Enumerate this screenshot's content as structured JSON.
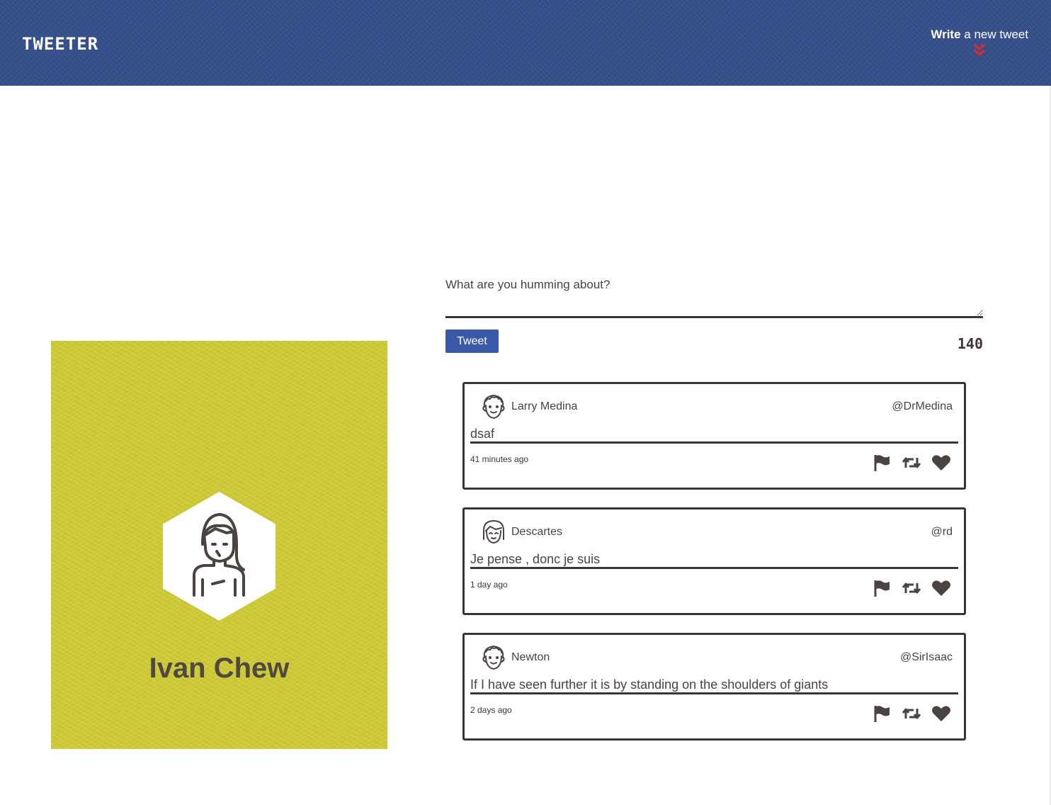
{
  "header": {
    "logo": "TWEETER",
    "compose_toggle_bold": "Write",
    "compose_toggle_rest": " a new tweet",
    "compose_toggle_icon": "double-chevron-down-icon",
    "accent_color": "#e8262c",
    "background_color": "#354f8a"
  },
  "profile": {
    "name": "Ivan Chew",
    "avatar_icon": "user-avatar-icon",
    "background_color": "#ccc934"
  },
  "composer": {
    "placeholder": "What are you humming about?",
    "value": "",
    "submit_label": "Tweet",
    "char_counter": "140"
  },
  "tweets": [
    {
      "name": "Larry Medina",
      "handle": "@DrMedina",
      "content": "dsaf",
      "time": "41 minutes ago"
    },
    {
      "name": "Descartes",
      "handle": "@rd",
      "content": "Je pense , donc je suis",
      "time": "1 day ago"
    },
    {
      "name": "Newton",
      "handle": "@SirIsaac",
      "content": "If I have seen further it is by standing on the shoulders of giants",
      "time": "2 days ago"
    }
  ],
  "tweet_actions": [
    "flag-icon",
    "retweet-icon",
    "heart-icon"
  ]
}
